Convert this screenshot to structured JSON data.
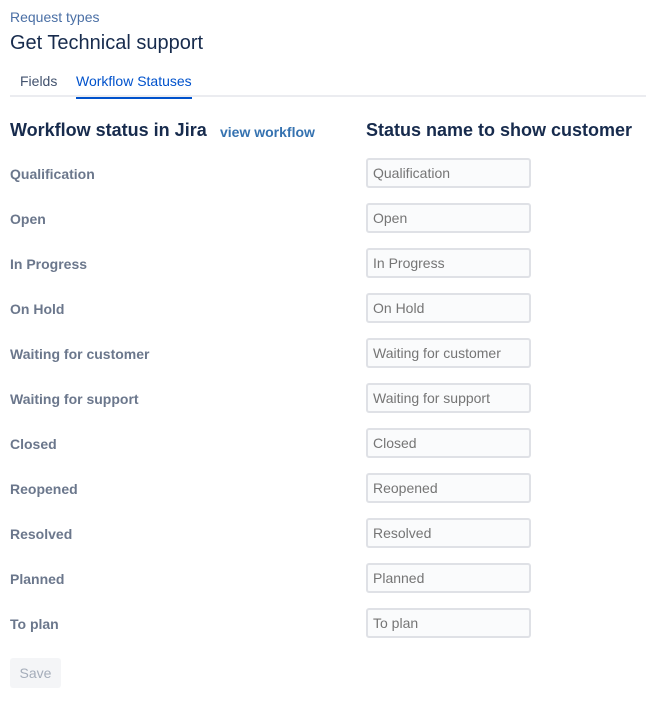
{
  "breadcrumb": "Request types",
  "title": "Get Technical support",
  "tabs": [
    {
      "label": "Fields",
      "active": false
    },
    {
      "label": "Workflow Statuses",
      "active": true
    }
  ],
  "headers": {
    "left": "Workflow status in Jira",
    "view_workflow": "view workflow",
    "right": "Status name to show customer"
  },
  "statuses": [
    {
      "label": "Qualification",
      "placeholder": "Qualification"
    },
    {
      "label": "Open",
      "placeholder": "Open"
    },
    {
      "label": "In Progress",
      "placeholder": "In Progress"
    },
    {
      "label": "On Hold",
      "placeholder": "On Hold"
    },
    {
      "label": "Waiting for customer",
      "placeholder": "Waiting for customer"
    },
    {
      "label": "Waiting for support",
      "placeholder": "Waiting for support"
    },
    {
      "label": "Closed",
      "placeholder": "Closed"
    },
    {
      "label": "Reopened",
      "placeholder": "Reopened"
    },
    {
      "label": "Resolved",
      "placeholder": "Resolved"
    },
    {
      "label": "Planned",
      "placeholder": "Planned"
    },
    {
      "label": "To plan",
      "placeholder": "To plan"
    }
  ],
  "save_label": "Save",
  "colors": {
    "accent": "#0052cc",
    "link": "#3572b0",
    "muted_label": "#6b778c"
  }
}
